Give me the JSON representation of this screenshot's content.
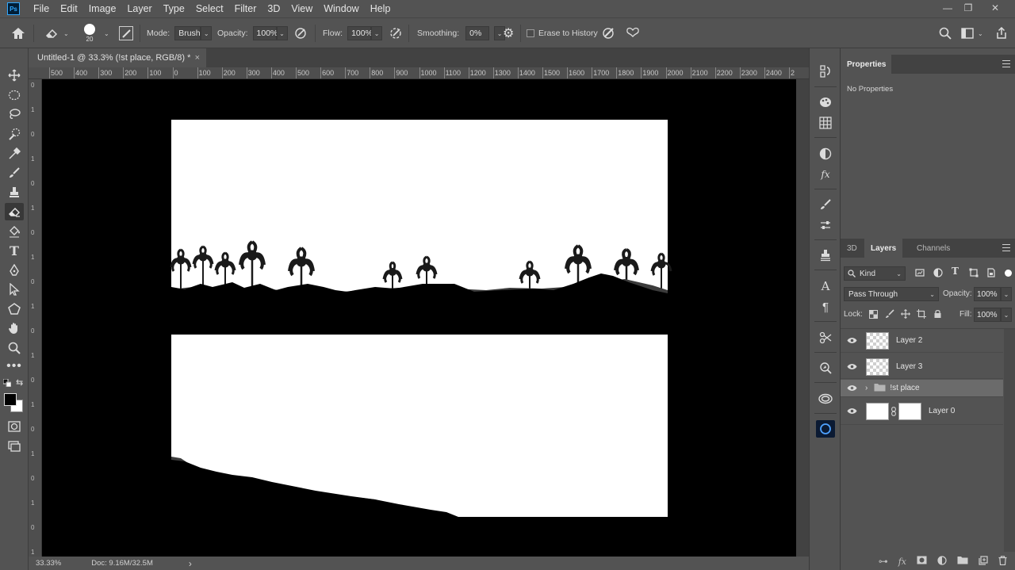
{
  "app": {
    "logo": "Ps",
    "menus": [
      "File",
      "Edit",
      "Image",
      "Layer",
      "Type",
      "Select",
      "Filter",
      "3D",
      "View",
      "Window",
      "Help"
    ],
    "window_controls": [
      "minimize",
      "restore",
      "close"
    ]
  },
  "options_bar": {
    "brush_size": "20",
    "mode_label": "Mode:",
    "mode_value": "Brush",
    "opacity_label": "Opacity:",
    "opacity_value": "100%",
    "flow_label": "Flow:",
    "flow_value": "100%",
    "smoothing_label": "Smoothing:",
    "smoothing_value": "0%",
    "erase_history_label": "Erase to History"
  },
  "document": {
    "tab_title": "Untitled-1 @ 33.3% (!st place, RGB/8) *",
    "close": "×"
  },
  "ruler": {
    "top_ticks": [
      "500",
      "400",
      "300",
      "200",
      "100",
      "0",
      "100",
      "200",
      "300",
      "400",
      "500",
      "600",
      "700",
      "800",
      "900",
      "1000",
      "1100",
      "1200",
      "1300",
      "1400",
      "1500",
      "1600",
      "1700",
      "1800",
      "1900",
      "2000",
      "2100",
      "2200",
      "2300",
      "2400",
      "2"
    ]
  },
  "status": {
    "zoom": "33.33%",
    "doc": "Doc: 9.16M/32.5M",
    "arrow": "›"
  },
  "properties_panel": {
    "tab": "Properties",
    "content": "No Properties"
  },
  "layers_panel": {
    "tabs": [
      "3D",
      "Layers",
      "Channels"
    ],
    "active_tab": "Layers",
    "filter_label": "Kind",
    "blend_mode": "Pass Through",
    "opacity_label": "Opacity:",
    "opacity_value": "100%",
    "lock_label": "Lock:",
    "fill_label": "Fill:",
    "fill_value": "100%",
    "layers": [
      {
        "name": "Layer 2",
        "type": "layer"
      },
      {
        "name": "Layer 3",
        "type": "layer"
      },
      {
        "name": "!st place",
        "type": "group",
        "selected": true
      },
      {
        "name": "Layer 0",
        "type": "masked"
      }
    ]
  }
}
